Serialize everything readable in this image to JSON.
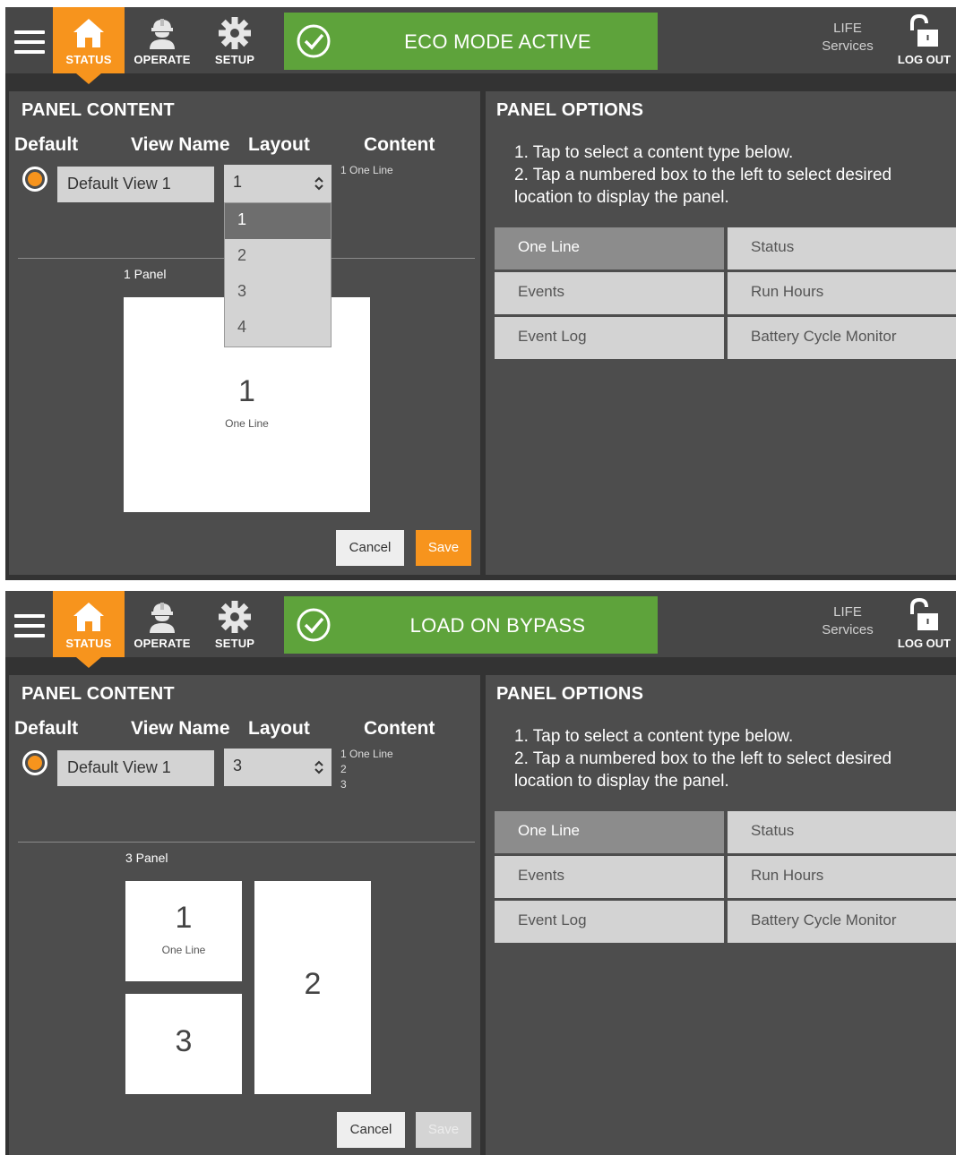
{
  "screens": [
    {
      "nav": {
        "status_label": "STATUS",
        "operate_label": "OPERATE",
        "setup_label": "SETUP",
        "banner_text": "ECO MODE ACTIVE",
        "life_line1": "LIFE",
        "life_line2": "Services",
        "logout_label": "LOG OUT"
      },
      "panel_content": {
        "title": "PANEL CONTENT",
        "col_default": "Default",
        "col_view_name": "View Name",
        "col_layout": "Layout",
        "col_content": "Content",
        "view_name_value": "Default View 1",
        "layout_value": "1",
        "layout_options": [
          "1",
          "2",
          "3",
          "4"
        ],
        "content_lines": [
          "1 One Line"
        ],
        "panel_label": "1 Panel",
        "boxes": [
          {
            "num": "1",
            "caption": "One Line"
          }
        ],
        "cancel_label": "Cancel",
        "save_label": "Save",
        "save_enabled": true
      },
      "panel_options": {
        "title": "PANEL OPTIONS",
        "instruction_1": "1. Tap to select a content type below.",
        "instruction_2": "2. Tap a numbered box to the left to select desired location to display the panel.",
        "options": [
          "One Line",
          "Status",
          "Events",
          "Run Hours",
          "Event Log",
          "Battery Cycle Monitor"
        ],
        "selected": "One Line"
      }
    },
    {
      "nav": {
        "status_label": "STATUS",
        "operate_label": "OPERATE",
        "setup_label": "SETUP",
        "banner_text": "LOAD ON BYPASS",
        "life_line1": "LIFE",
        "life_line2": "Services",
        "logout_label": "LOG OUT"
      },
      "panel_content": {
        "title": "PANEL CONTENT",
        "col_default": "Default",
        "col_view_name": "View Name",
        "col_layout": "Layout",
        "col_content": "Content",
        "view_name_value": "Default View 1",
        "layout_value": "3",
        "content_lines": [
          "1 One Line",
          "2",
          "3"
        ],
        "panel_label": "3 Panel",
        "boxes": [
          {
            "num": "1",
            "caption": "One Line"
          },
          {
            "num": "2",
            "caption": ""
          },
          {
            "num": "3",
            "caption": ""
          }
        ],
        "cancel_label": "Cancel",
        "save_label": "Save",
        "save_enabled": false
      },
      "panel_options": {
        "title": "PANEL OPTIONS",
        "instruction_1": "1. Tap to select a content type below.",
        "instruction_2": "2. Tap a numbered box to the left to select desired location to display the panel.",
        "options": [
          "One Line",
          "Status",
          "Events",
          "Run Hours",
          "Event Log",
          "Battery Cycle Monitor"
        ],
        "selected": "One Line"
      }
    }
  ],
  "colors": {
    "accent_orange": "#f7941d",
    "banner_green": "#5ea33b",
    "topbar": "#474747",
    "panel_bg": "#4d4d4d"
  },
  "icons": [
    "menu-icon",
    "home-icon",
    "worker-icon",
    "gear-icon",
    "check-circle-icon",
    "unlocked-padlock-icon",
    "select-arrows-icon"
  ]
}
